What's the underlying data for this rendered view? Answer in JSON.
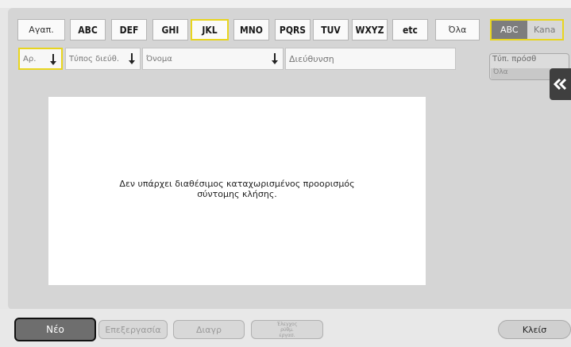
{
  "index_tabs": [
    {
      "label": "Αγαπ.",
      "state": "normal"
    },
    {
      "label": "ABC",
      "state": "normal"
    },
    {
      "label": "DEF",
      "state": "normal"
    },
    {
      "label": "GHI",
      "state": "normal"
    },
    {
      "label": "JKL",
      "state": "selected"
    },
    {
      "label": "MNO",
      "state": "normal"
    },
    {
      "label": "PQRS",
      "state": "normal"
    },
    {
      "label": "TUV",
      "state": "normal"
    },
    {
      "label": "WXYZ",
      "state": "normal"
    },
    {
      "label": "etc",
      "state": "normal"
    },
    {
      "label": "Όλα",
      "state": "normal"
    }
  ],
  "script_toggle": {
    "abc": "ABC",
    "kana": "Kana",
    "active": "abc"
  },
  "columns": {
    "number": "Αρ.",
    "address_type": "Τύπος διεύθ.",
    "name": "Όνομα",
    "address": "Διεύθυνση"
  },
  "address_type_filter": {
    "label": "Τύπ. πρόσθ",
    "value": "Όλα"
  },
  "list": {
    "empty_message_line1": "Δεν υπάρχει διαθέσιμος καταχωρισμένος προορισμός",
    "empty_message_line2": "σύντομης κλήσης."
  },
  "actions": {
    "new": "Νέο",
    "edit": "Επεξεργασία",
    "delete": "Διαγρ",
    "check_line1": "Έλεγχος",
    "check_line2": "ρύθμ.",
    "check_line3": "εργασ.",
    "close": "Κλείσ"
  },
  "colors": {
    "selection_highlight": "#e8d51f",
    "active_button": "#6e6e6e",
    "panel": "#d5d5d5"
  }
}
